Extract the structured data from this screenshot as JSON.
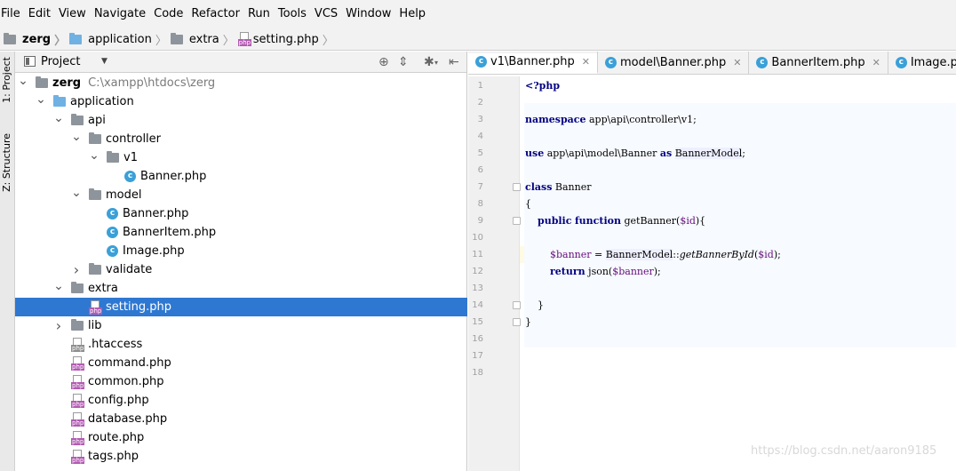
{
  "menu": [
    "File",
    "Edit",
    "View",
    "Navigate",
    "Code",
    "Refactor",
    "Run",
    "Tools",
    "VCS",
    "Window",
    "Help"
  ],
  "breadcrumb": [
    "zerg",
    "application",
    "extra",
    "setting.php"
  ],
  "toolstrip": {
    "project_tab": "1: Project",
    "structure_tab": "Z: Structure"
  },
  "project_panel": {
    "title": "Project"
  },
  "tree": [
    {
      "label": "zerg",
      "path": "C:\\xampp\\htdocs\\zerg",
      "depth": 0,
      "arrow": "open",
      "icon": "folder-gray",
      "bold": true
    },
    {
      "label": "application",
      "depth": 1,
      "arrow": "open",
      "icon": "folder-blue"
    },
    {
      "label": "api",
      "depth": 2,
      "arrow": "open",
      "icon": "folder-gray"
    },
    {
      "label": "controller",
      "depth": 3,
      "arrow": "open",
      "icon": "folder-gray"
    },
    {
      "label": "v1",
      "depth": 4,
      "arrow": "open",
      "icon": "folder-gray"
    },
    {
      "label": "Banner.php",
      "depth": 5,
      "arrow": "none",
      "icon": "class"
    },
    {
      "label": "model",
      "depth": 3,
      "arrow": "open",
      "icon": "folder-gray"
    },
    {
      "label": "Banner.php",
      "depth": 4,
      "arrow": "none",
      "icon": "class"
    },
    {
      "label": "BannerItem.php",
      "depth": 4,
      "arrow": "none",
      "icon": "class"
    },
    {
      "label": "Image.php",
      "depth": 4,
      "arrow": "none",
      "icon": "class"
    },
    {
      "label": "validate",
      "depth": 3,
      "arrow": "closed",
      "icon": "folder-gray"
    },
    {
      "label": "extra",
      "depth": 2,
      "arrow": "open",
      "icon": "folder-gray"
    },
    {
      "label": "setting.php",
      "depth": 3,
      "arrow": "none",
      "icon": "php",
      "selected": true
    },
    {
      "label": "lib",
      "depth": 2,
      "arrow": "closed",
      "icon": "folder-gray"
    },
    {
      "label": ".htaccess",
      "depth": 2,
      "arrow": "none",
      "icon": "file-plain"
    },
    {
      "label": "command.php",
      "depth": 2,
      "arrow": "none",
      "icon": "php"
    },
    {
      "label": "common.php",
      "depth": 2,
      "arrow": "none",
      "icon": "php"
    },
    {
      "label": "config.php",
      "depth": 2,
      "arrow": "none",
      "icon": "php"
    },
    {
      "label": "database.php",
      "depth": 2,
      "arrow": "none",
      "icon": "php"
    },
    {
      "label": "route.php",
      "depth": 2,
      "arrow": "none",
      "icon": "php"
    },
    {
      "label": "tags.php",
      "depth": 2,
      "arrow": "none",
      "icon": "php"
    }
  ],
  "tabs": [
    {
      "label": "v1\\Banner.php",
      "active": true
    },
    {
      "label": "model\\Banner.php",
      "active": false
    },
    {
      "label": "BannerItem.php",
      "active": false
    },
    {
      "label": "Image.php",
      "active": false
    }
  ],
  "code": {
    "line_numbers": [
      "1",
      "2",
      "3",
      "4",
      "5",
      "6",
      "7",
      "8",
      "9",
      "10",
      "11",
      "12",
      "13",
      "14",
      "15",
      "16",
      "17",
      "18"
    ],
    "current_line": 11,
    "lines": [
      "<?php",
      "",
      "namespace app\\api\\controller\\v1;",
      "",
      "use app\\api\\model\\Banner as BannerModel;",
      "",
      "class Banner",
      "{",
      "    public function getBanner($id){",
      "",
      "        $banner = BannerModel::getBannerById($id);",
      "        return json($banner);",
      "",
      "    }",
      "}",
      "",
      "",
      ""
    ]
  },
  "watermark": "https://blog.csdn.net/aaron9185"
}
